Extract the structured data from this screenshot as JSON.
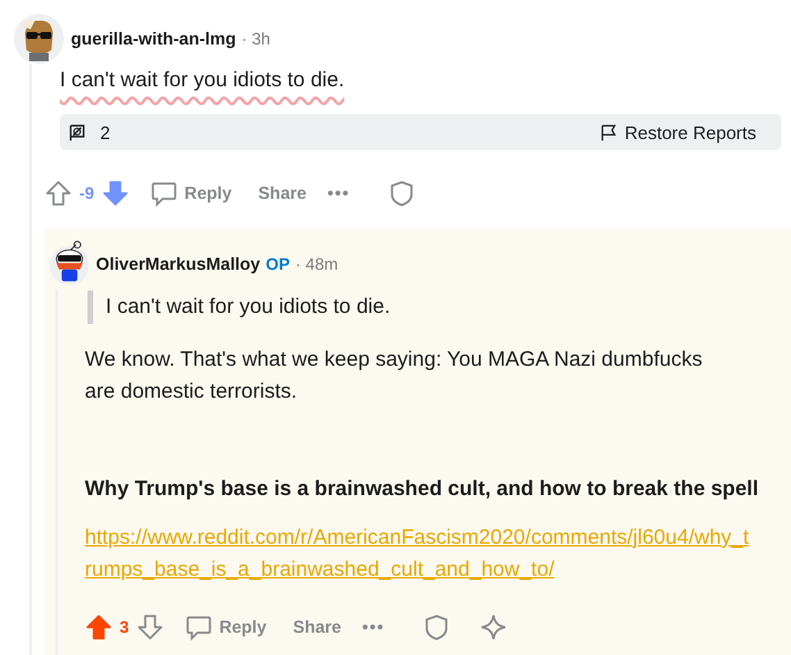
{
  "comments": [
    {
      "author": "guerilla-with-an-lmg",
      "time": "· 3h",
      "highlighted": false,
      "blocks": [
        {
          "kind": "paragraph",
          "text": "I can't wait for you idiots to die.",
          "underlined": true
        }
      ],
      "reports": {
        "icon_text": "2",
        "action": "Restore Reports"
      },
      "score": "-9",
      "upvoted": false,
      "downvoted": true,
      "actions": [
        "Reply",
        "Share"
      ],
      "more": "•••",
      "award": false,
      "children": [
        {
          "author": "OliverMarkusMalloy",
          "op_label": "OP",
          "time": "· 48m",
          "highlighted": true,
          "blocks": [
            {
              "kind": "quote",
              "text": "I can't wait for you idiots to die.",
              "underlined": false
            },
            {
              "kind": "paragraph",
              "text": "We know. That's what we keep saying: You MAGA Nazi dumbfucks are domestic terrorists.",
              "underlined": false
            },
            {
              "kind": "heading",
              "text": "Why Trump's base is a brainwashed cult, and how to break the spell",
              "underlined": false
            },
            {
              "kind": "link",
              "text": "https://www.reddit.com/r/AmericanFascism2020/comments/jl60u4/why_trumps_base_is_a_brainwashed_cult_and_how_to/",
              "underlined": false
            }
          ],
          "score": "3",
          "upvoted": true,
          "downvoted": false,
          "actions": [
            "Reply",
            "Share"
          ],
          "more": "•••",
          "award": true
        }
      ]
    }
  ]
}
